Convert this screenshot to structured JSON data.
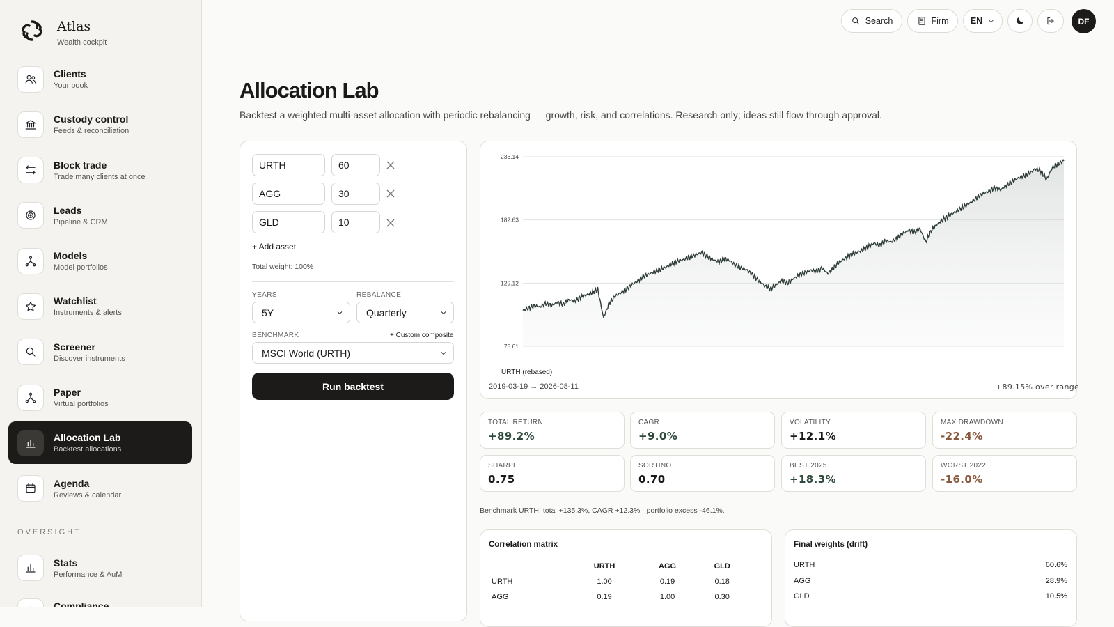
{
  "brand": {
    "name": "Atlas",
    "subtitle": "Wealth cockpit"
  },
  "nav": [
    {
      "label": "Clients",
      "sub": "Your book",
      "icon": "users-icon"
    },
    {
      "label": "Custody control",
      "sub": "Feeds & reconciliation",
      "icon": "bank-icon"
    },
    {
      "label": "Block trade",
      "sub": "Trade many clients at once",
      "icon": "swap-arrows-icon"
    },
    {
      "label": "Leads",
      "sub": "Pipeline & CRM",
      "icon": "target-icon"
    },
    {
      "label": "Models",
      "sub": "Model portfolios",
      "icon": "nodes-icon"
    },
    {
      "label": "Watchlist",
      "sub": "Instruments & alerts",
      "icon": "star-icon"
    },
    {
      "label": "Screener",
      "sub": "Discover instruments",
      "icon": "search-icon"
    },
    {
      "label": "Paper",
      "sub": "Virtual portfolios",
      "icon": "nodes-icon"
    },
    {
      "label": "Allocation Lab",
      "sub": "Backtest allocations",
      "icon": "bar-chart-icon",
      "active": true
    },
    {
      "label": "Agenda",
      "sub": "Reviews & calendar",
      "icon": "calendar-icon"
    }
  ],
  "oversight_label": "OVERSIGHT",
  "oversight": [
    {
      "label": "Stats",
      "sub": "Performance & AuM",
      "icon": "bar-chart-icon"
    },
    {
      "label": "Compliance",
      "sub": "",
      "icon": "shield-icon"
    }
  ],
  "topbar": {
    "search": "Search",
    "firm": "Firm",
    "lang": "EN",
    "avatar": "DF"
  },
  "page": {
    "title": "Allocation Lab",
    "description": "Backtest a weighted multi-asset allocation with periodic rebalancing — growth, risk, and correlations. Research only; ideas still flow through approval."
  },
  "form": {
    "assets": [
      {
        "ticker": "URTH",
        "weight": "60"
      },
      {
        "ticker": "AGG",
        "weight": "30"
      },
      {
        "ticker": "GLD",
        "weight": "10"
      }
    ],
    "add_asset": "+ Add asset",
    "total_weight": "Total weight: 100%",
    "years_label": "YEARS",
    "years_value": "5Y",
    "rebalance_label": "REBALANCE",
    "rebalance_value": "Quarterly",
    "benchmark_label": "BENCHMARK",
    "custom_composite": "+ Custom composite",
    "benchmark_value": "MSCI World (URTH)",
    "run_label": "Run backtest"
  },
  "chart_data": {
    "type": "area",
    "yticks": [
      "236.14",
      "182.63",
      "129.12",
      "75.61"
    ],
    "ylim": [
      75.61,
      236.14
    ],
    "legend": "URTH (rebased)",
    "range_label": "2019-03-19 → 2026-08-11",
    "summary": "+89.15% over range",
    "x_start": "2019-03-19",
    "x_end": "2026-08-11",
    "series": [
      {
        "values": [
          106,
          108,
          110,
          109,
          112,
          110,
          113,
          111,
          115,
          114,
          117,
          119,
          121,
          124,
          100,
          112,
          118,
          121,
          124,
          128,
          131,
          135,
          137,
          139,
          141,
          143,
          146,
          148,
          149,
          151,
          153,
          155,
          152,
          149,
          147,
          150,
          148,
          144,
          142,
          140,
          136,
          131,
          127,
          124,
          128,
          131,
          129,
          133,
          136,
          138,
          140,
          139,
          142,
          137,
          142,
          147,
          150,
          153,
          155,
          157,
          160,
          163,
          161,
          165,
          164,
          167,
          171,
          174,
          172,
          175,
          164,
          174,
          179,
          183,
          186,
          189,
          192,
          195,
          198,
          202,
          205,
          207,
          210,
          208,
          212,
          215,
          218,
          220,
          222,
          226,
          224,
          217,
          227,
          230,
          233
        ]
      }
    ]
  },
  "metrics": [
    {
      "label": "TOTAL RETURN",
      "value": "+89.2%",
      "tone": "pos"
    },
    {
      "label": "CAGR",
      "value": "+9.0%",
      "tone": "pos"
    },
    {
      "label": "VOLATILITY",
      "value": "+12.1%",
      "tone": "neu"
    },
    {
      "label": "MAX DRAWDOWN",
      "value": "-22.4%",
      "tone": "neg"
    },
    {
      "label": "SHARPE",
      "value": "0.75",
      "tone": "neu"
    },
    {
      "label": "SORTINO",
      "value": "0.70",
      "tone": "neu"
    },
    {
      "label": "BEST 2025",
      "value": "+18.3%",
      "tone": "pos"
    },
    {
      "label": "WORST 2022",
      "value": "-16.0%",
      "tone": "neg"
    }
  ],
  "benchmark_note": "Benchmark URTH: total +135.3%, CAGR +12.3% · portfolio excess -46.1%.",
  "correlation": {
    "title": "Correlation matrix",
    "headers": [
      "",
      "URTH",
      "AGG",
      "GLD"
    ],
    "rows": [
      [
        "URTH",
        "1.00",
        "0.19",
        "0.18"
      ],
      [
        "AGG",
        "0.19",
        "1.00",
        "0.30"
      ]
    ]
  },
  "final_weights": {
    "title": "Final weights (drift)",
    "rows": [
      {
        "ticker": "URTH",
        "value": "60.6%"
      },
      {
        "ticker": "AGG",
        "value": "28.9%"
      },
      {
        "ticker": "GLD",
        "value": "10.5%"
      }
    ]
  }
}
